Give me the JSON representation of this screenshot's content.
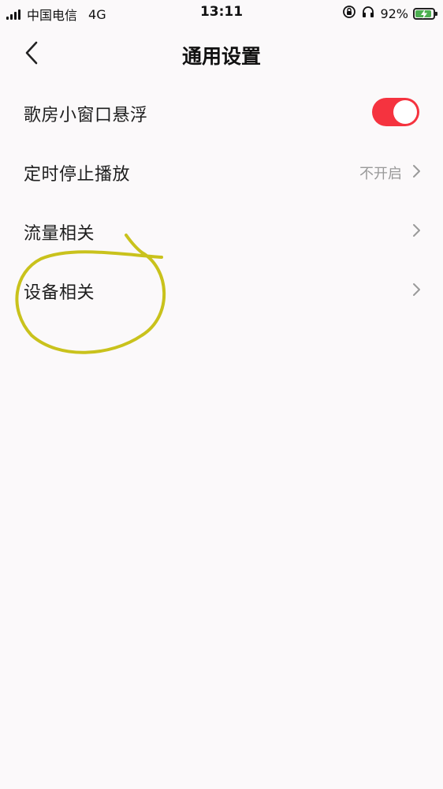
{
  "status_bar": {
    "carrier": "中国电信",
    "network": "4G",
    "time": "13:11",
    "battery_percent": "92%",
    "battery_level": 0.92,
    "icons": [
      "signal-icon",
      "rotation-lock-icon",
      "headphones-icon",
      "battery-charging-icon"
    ]
  },
  "header": {
    "title": "通用设置",
    "back_icon": "chevron-left-icon"
  },
  "settings": [
    {
      "label": "歌房小窗口悬浮",
      "control": "toggle",
      "on": true
    },
    {
      "label": "定时停止播放",
      "value": "不开启",
      "control": "chevron"
    },
    {
      "label": "流量相关",
      "control": "chevron"
    },
    {
      "label": "设备相关",
      "control": "chevron"
    }
  ],
  "colors": {
    "background": "#fbf9fa",
    "toggle_on": "#f5333f",
    "annotation_stroke": "#c9c21c",
    "battery_fill": "#4caf50"
  }
}
